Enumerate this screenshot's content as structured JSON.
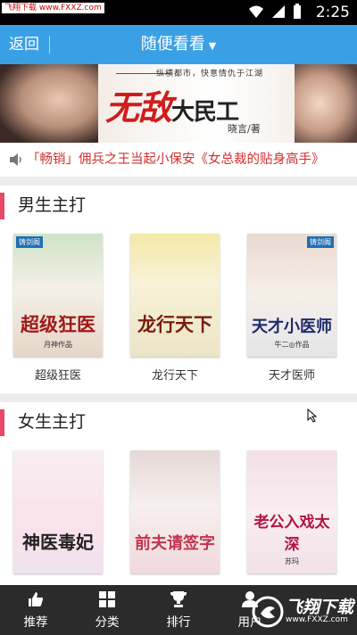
{
  "status_bar": {
    "time": "2:25",
    "watermark": "飞翔下载 www.FXXZ.com"
  },
  "header": {
    "back_label": "返回",
    "title": "随便看看",
    "title_caret": "▼"
  },
  "banner": {
    "slogan": "纵横都市，快意情仇于江湖",
    "title_red": "无敌",
    "title_black": "大民工",
    "author": "晓言/著"
  },
  "notice": {
    "text": "「畅销」佣兵之王当起小保安《女总裁的贴身高手》"
  },
  "sections": [
    {
      "label": "男生主打",
      "books": [
        {
          "name": "超级狂医",
          "cover_title": "超级狂医",
          "cover_tag": "铸剑阁",
          "cover_author": "月神作品"
        },
        {
          "name": "龙行天下",
          "cover_title": "龙行天下",
          "cover_tag": "",
          "cover_author": ""
        },
        {
          "name": "天才医师",
          "cover_title": "天才小医师",
          "cover_tag": "铸剑阁",
          "cover_author": "牛二◎作品"
        }
      ]
    },
    {
      "label": "女生主打",
      "books": [
        {
          "name": "",
          "cover_title": "神医毒妃",
          "cover_tag": "",
          "cover_author": ""
        },
        {
          "name": "",
          "cover_title": "前夫请签字",
          "cover_tag": "",
          "cover_author": ""
        },
        {
          "name": "",
          "cover_title": "老公入戏太深",
          "cover_tag": "",
          "cover_author": "苏玛"
        }
      ]
    }
  ],
  "bottom_nav": [
    {
      "label": "推荐",
      "icon": "thumbs-up-icon"
    },
    {
      "label": "分类",
      "icon": "grid-icon"
    },
    {
      "label": "排行",
      "icon": "trophy-icon"
    },
    {
      "label": "用户",
      "icon": "user-icon"
    }
  ],
  "corner_watermark": {
    "text": "飞翔下载",
    "url": "www.FXXZ.com"
  },
  "colors": {
    "header_bg": "#3aa0e6",
    "accent_pink": "#e8486a",
    "notice_red": "#d32f2f",
    "nav_bg": "#2b2b2b"
  }
}
